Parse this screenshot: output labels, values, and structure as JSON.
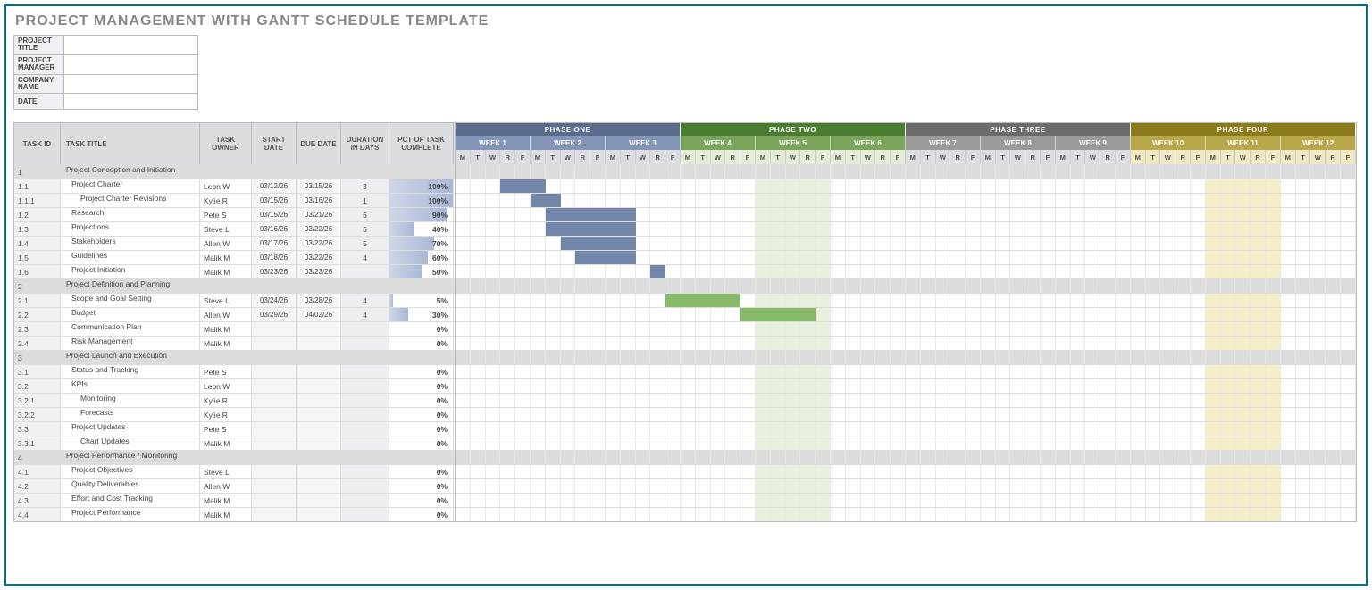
{
  "title": "PROJECT MANAGEMENT WITH GANTT SCHEDULE TEMPLATE",
  "meta_labels": {
    "project_title": "PROJECT TITLE",
    "project_manager": "PROJECT MANAGER",
    "company_name": "COMPANY NAME",
    "date": "DATE"
  },
  "columns": {
    "id": "TASK ID",
    "name": "TASK TITLE",
    "owner": "TASK OWNER",
    "start": "START DATE",
    "due": "DUE DATE",
    "dur": "DURATION IN DAYS",
    "pct": "PCT OF TASK COMPLETE"
  },
  "phases": [
    {
      "label": "PHASE ONE",
      "weeks": [
        "WEEK 1",
        "WEEK 2",
        "WEEK 3"
      ],
      "color": "#5a6b8c",
      "wkcolor": "#8395b8"
    },
    {
      "label": "PHASE TWO",
      "weeks": [
        "WEEK 4",
        "WEEK 5",
        "WEEK 6"
      ],
      "color": "#4a7c31",
      "wkcolor": "#7ba55a"
    },
    {
      "label": "PHASE THREE",
      "weeks": [
        "WEEK 7",
        "WEEK 8",
        "WEEK 9"
      ],
      "color": "#6b6b6b",
      "wkcolor": "#9a9a9a"
    },
    {
      "label": "PHASE FOUR",
      "weeks": [
        "WEEK 10",
        "WEEK 11",
        "WEEK 12"
      ],
      "color": "#8a7a1a",
      "wkcolor": "#b8a84a"
    }
  ],
  "day_letters": [
    "M",
    "T",
    "W",
    "R",
    "F"
  ],
  "highlight_weeks": [
    5,
    11
  ],
  "rows": [
    {
      "id": "1",
      "name": "Project Conception and Initiation",
      "header": true
    },
    {
      "id": "1.1",
      "name": "Project Charter",
      "indent": 1,
      "owner": "Leon W",
      "start": "03/12/26",
      "due": "03/15/26",
      "dur": "3",
      "pct": 100,
      "bar": {
        "start": 4,
        "len": 3,
        "phase": 1
      }
    },
    {
      "id": "1.1.1",
      "name": "Project Charter Revisions",
      "indent": 2,
      "owner": "Kylie R",
      "start": "03/15/26",
      "due": "03/16/26",
      "dur": "1",
      "pct": 100,
      "bar": {
        "start": 6,
        "len": 2,
        "phase": 1
      }
    },
    {
      "id": "1.2",
      "name": "Research",
      "indent": 1,
      "owner": "Pete S",
      "start": "03/15/26",
      "due": "03/21/26",
      "dur": "6",
      "pct": 90,
      "bar": {
        "start": 7,
        "len": 6,
        "phase": 1
      }
    },
    {
      "id": "1.3",
      "name": "Projections",
      "indent": 1,
      "owner": "Steve L",
      "start": "03/16/26",
      "due": "03/22/26",
      "dur": "6",
      "pct": 40,
      "bar": {
        "start": 7,
        "len": 6,
        "phase": 1
      }
    },
    {
      "id": "1.4",
      "name": "Stakeholders",
      "indent": 1,
      "owner": "Allen W",
      "start": "03/17/26",
      "due": "03/22/26",
      "dur": "5",
      "pct": 70,
      "bar": {
        "start": 8,
        "len": 5,
        "phase": 1
      }
    },
    {
      "id": "1.5",
      "name": "Guidelines",
      "indent": 1,
      "owner": "Malik M",
      "start": "03/18/26",
      "due": "03/22/26",
      "dur": "4",
      "pct": 60,
      "bar": {
        "start": 9,
        "len": 4,
        "phase": 1
      }
    },
    {
      "id": "1.6",
      "name": "Project Initiation",
      "indent": 1,
      "owner": "Malik M",
      "start": "03/23/26",
      "due": "03/23/26",
      "dur": "",
      "pct": 50,
      "bar": {
        "start": 14,
        "len": 1,
        "phase": 1
      }
    },
    {
      "id": "2",
      "name": "Project Definition and Planning",
      "header": true
    },
    {
      "id": "2.1",
      "name": "Scope and Goal Setting",
      "indent": 1,
      "owner": "Steve L",
      "start": "03/24/26",
      "due": "03/28/26",
      "dur": "4",
      "pct": 5,
      "bar": {
        "start": 15,
        "len": 5,
        "phase": 2
      }
    },
    {
      "id": "2.2",
      "name": "Budget",
      "indent": 1,
      "owner": "Allen W",
      "start": "03/29/26",
      "due": "04/02/26",
      "dur": "4",
      "pct": 30,
      "bar": {
        "start": 20,
        "len": 5,
        "phase": 2
      }
    },
    {
      "id": "2.3",
      "name": "Communication Plan",
      "indent": 1,
      "owner": "Malik M",
      "start": "",
      "due": "",
      "dur": "",
      "pct": 0
    },
    {
      "id": "2.4",
      "name": "Risk Management",
      "indent": 1,
      "owner": "Malik M",
      "start": "",
      "due": "",
      "dur": "",
      "pct": 0
    },
    {
      "id": "3",
      "name": "Project Launch and Execution",
      "header": true
    },
    {
      "id": "3.1",
      "name": "Status and Tracking",
      "indent": 1,
      "owner": "Pete S",
      "start": "",
      "due": "",
      "dur": "",
      "pct": 0
    },
    {
      "id": "3.2",
      "name": "KPIs",
      "indent": 1,
      "owner": "Leon W",
      "start": "",
      "due": "",
      "dur": "",
      "pct": 0
    },
    {
      "id": "3.2.1",
      "name": "Monitoring",
      "indent": 2,
      "owner": "Kylie R",
      "start": "",
      "due": "",
      "dur": "",
      "pct": 0
    },
    {
      "id": "3.2.2",
      "name": "Forecasts",
      "indent": 2,
      "owner": "Kylie R",
      "start": "",
      "due": "",
      "dur": "",
      "pct": 0
    },
    {
      "id": "3.3",
      "name": "Project Updates",
      "indent": 1,
      "owner": "Pete S",
      "start": "",
      "due": "",
      "dur": "",
      "pct": 0
    },
    {
      "id": "3.3.1",
      "name": "Chart Updates",
      "indent": 2,
      "owner": "Malik M",
      "start": "",
      "due": "",
      "dur": "",
      "pct": 0
    },
    {
      "id": "4",
      "name": "Project Performance / Monitoring",
      "header": true
    },
    {
      "id": "4.1",
      "name": "Project Objectives",
      "indent": 1,
      "owner": "Steve L",
      "start": "",
      "due": "",
      "dur": "",
      "pct": 0
    },
    {
      "id": "4.2",
      "name": "Quality Deliverables",
      "indent": 1,
      "owner": "Allen W",
      "start": "",
      "due": "",
      "dur": "",
      "pct": 0
    },
    {
      "id": "4.3",
      "name": "Effort and Cost Tracking",
      "indent": 1,
      "owner": "Malik M",
      "start": "",
      "due": "",
      "dur": "",
      "pct": 0
    },
    {
      "id": "4.4",
      "name": "Project Performance",
      "indent": 1,
      "owner": "Malik M",
      "start": "",
      "due": "",
      "dur": "",
      "pct": 0
    }
  ]
}
